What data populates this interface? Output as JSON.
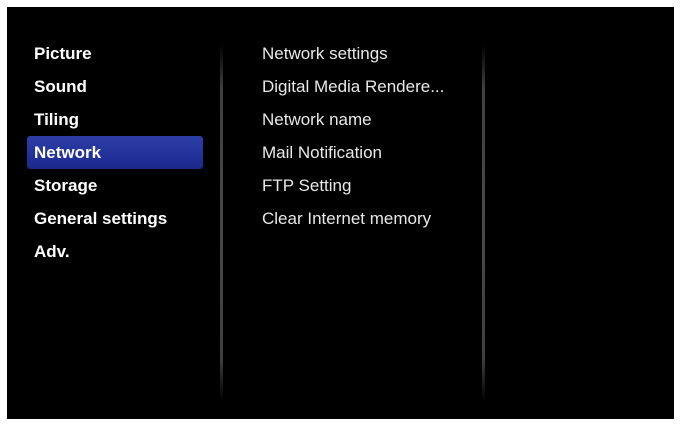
{
  "main_menu": {
    "items": [
      {
        "label": "Picture",
        "selected": false
      },
      {
        "label": "Sound",
        "selected": false
      },
      {
        "label": "Tiling",
        "selected": false
      },
      {
        "label": "Network",
        "selected": true
      },
      {
        "label": "Storage",
        "selected": false
      },
      {
        "label": "General settings",
        "selected": false
      },
      {
        "label": "Adv.",
        "selected": false
      }
    ]
  },
  "submenu": {
    "items": [
      {
        "label": "Network settings"
      },
      {
        "label": "Digital Media Rendere..."
      },
      {
        "label": "Network name"
      },
      {
        "label": "Mail Notification"
      },
      {
        "label": "FTP Setting"
      },
      {
        "label": "Clear Internet memory"
      }
    ]
  },
  "colors": {
    "background": "#000000",
    "selection": "#22319a",
    "text": "#ffffff"
  }
}
